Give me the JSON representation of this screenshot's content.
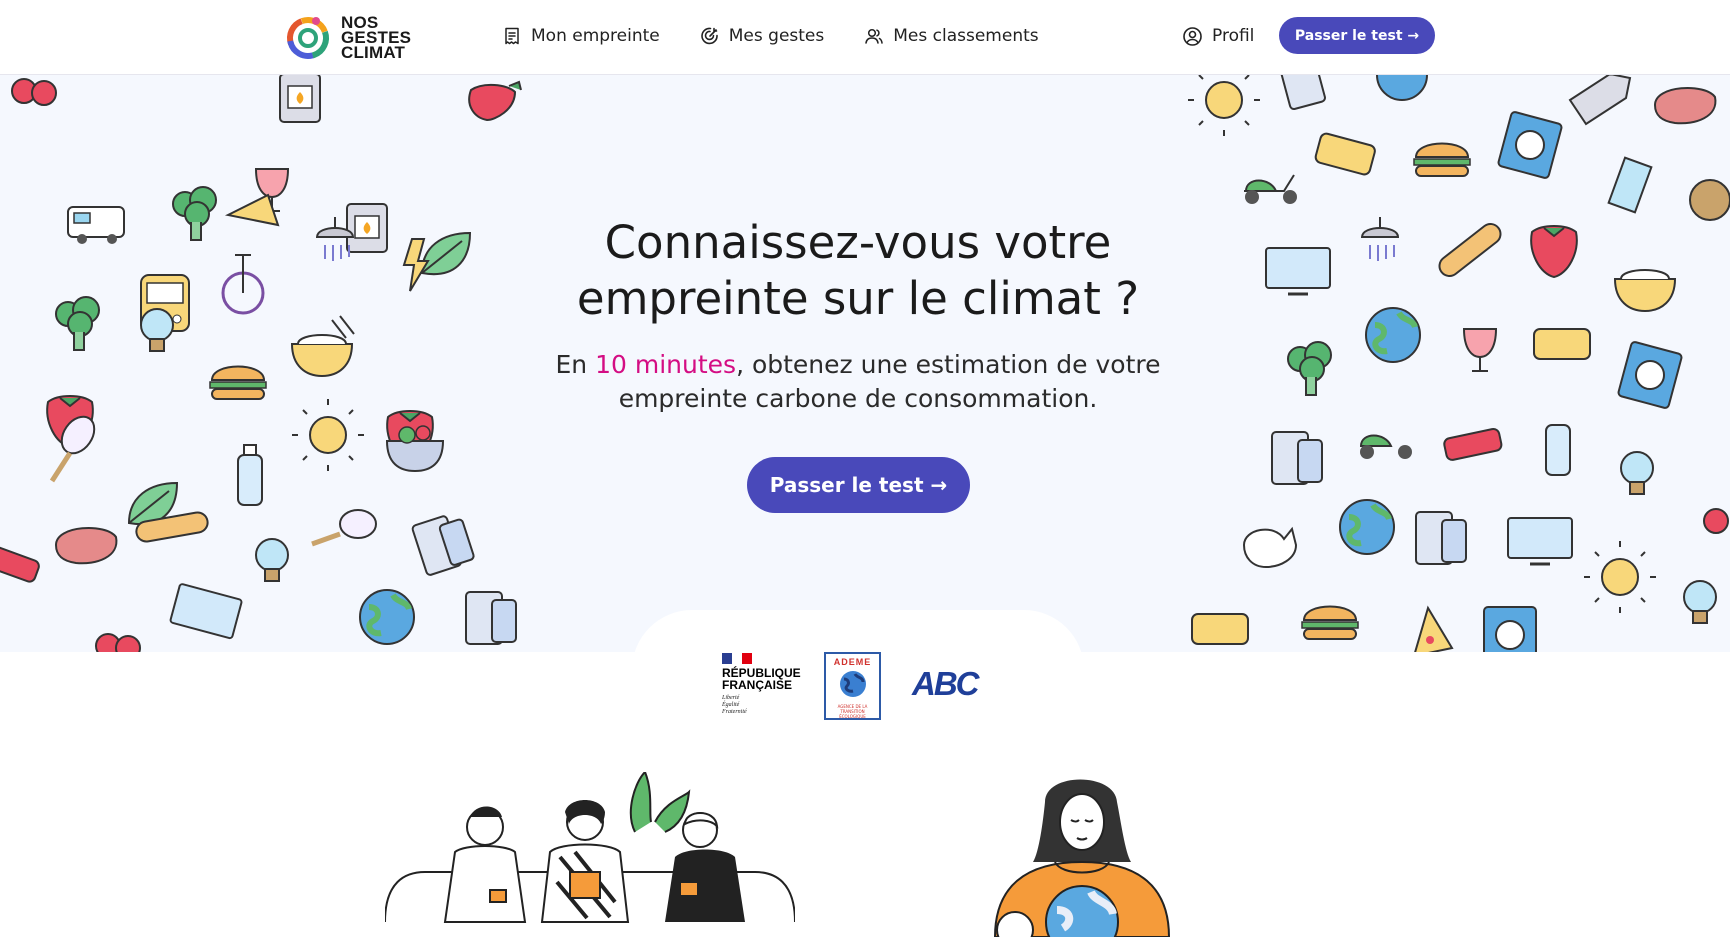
{
  "header": {
    "logo": {
      "line1": "NOS",
      "line2": "GESTES",
      "line3": "CLIMAT"
    },
    "nav": [
      {
        "label": "Mon empreinte",
        "icon": "document-icon"
      },
      {
        "label": "Mes gestes",
        "icon": "target-icon"
      },
      {
        "label": "Mes classements",
        "icon": "people-icon"
      }
    ],
    "profile_label": "Profil",
    "cta_label": "Passer le test →"
  },
  "hero": {
    "title": "Connaissez-vous votre empreinte sur le climat ?",
    "subtitle_prefix": "En ",
    "subtitle_accent": "10 minutes",
    "subtitle_suffix": ", obtenez une estimation de votre empreinte carbone de consommation.",
    "cta_label": "Passer le test →"
  },
  "partners": {
    "rf": {
      "line1": "RÉPUBLIQUE",
      "line2": "FRANÇAISE",
      "motto1": "Liberté",
      "motto2": "Égalité",
      "motto3": "Fraternité"
    },
    "ademe": {
      "name": "ADEME",
      "sub": "AGENCE DE LA TRANSITION ÉCOLOGIQUE"
    },
    "abc": "ABC"
  },
  "colors": {
    "primary": "#4949ba",
    "accent": "#d40d83",
    "hero_bg": "#f5f8fe"
  }
}
